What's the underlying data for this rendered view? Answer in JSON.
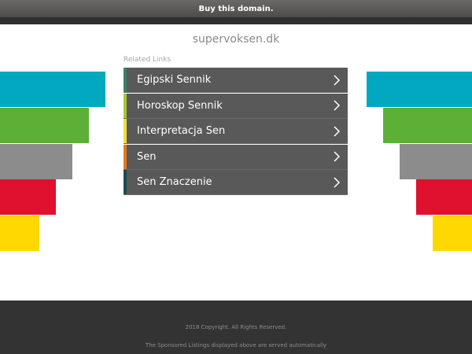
{
  "topbar": {
    "label": "Buy this domain."
  },
  "domain": {
    "name": "supervoksen.dk"
  },
  "related": {
    "heading": "Related Links"
  },
  "links": [
    {
      "label": "Egipski Sennik",
      "accent": "#3d7f6a"
    },
    {
      "label": "Horoskop Sennik",
      "accent": "#a9c43a"
    },
    {
      "label": "Interpretacja Sen",
      "accent": "#f1dc3a"
    },
    {
      "label": "Sen",
      "accent": "#e07a1b"
    },
    {
      "label": "Sen Znaczenie",
      "accent": "#1e4a55"
    }
  ],
  "decor": {
    "colors": [
      "#00a8c0",
      "#5bb035",
      "#8c8c8c",
      "#e0102f",
      "#fed800"
    ]
  },
  "footer": {
    "copyright": "2018 Copyright. All Rights Reserved.",
    "disclaimer": "The Sponsored Listings displayed above are served automatically"
  }
}
